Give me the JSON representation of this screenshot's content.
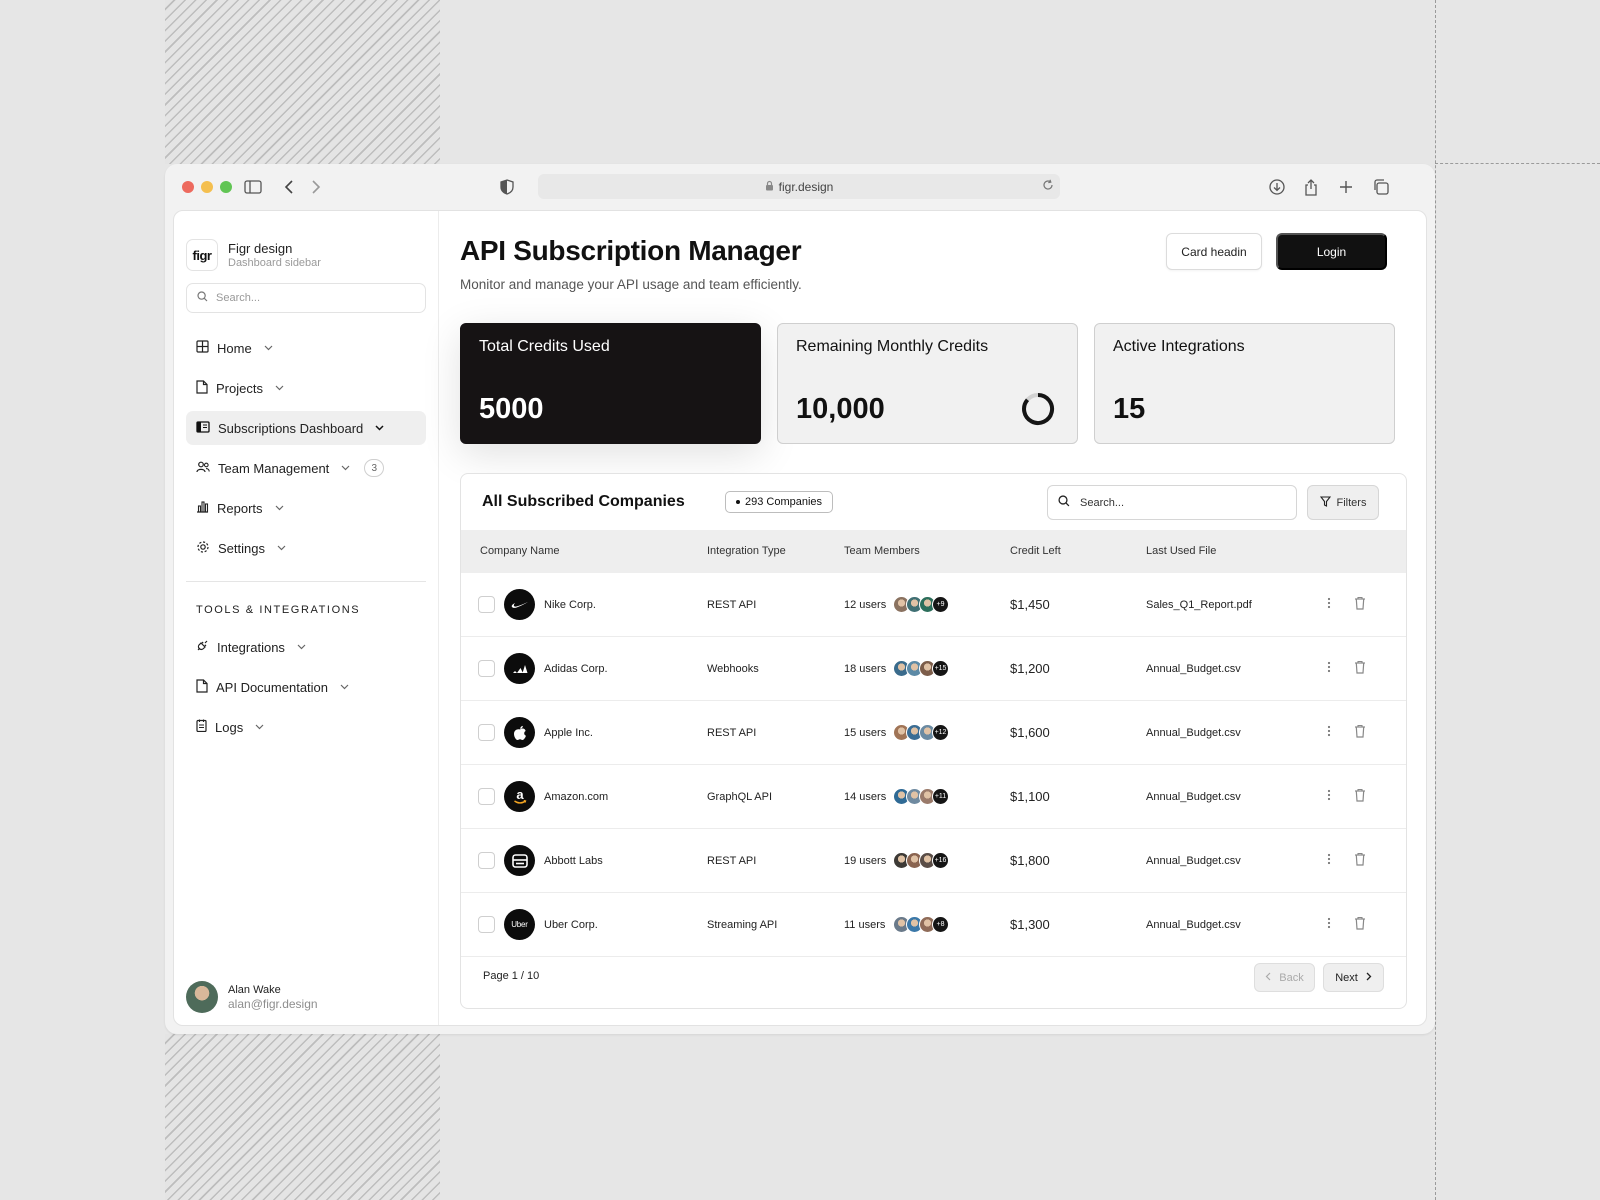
{
  "browser": {
    "url": "figr.design"
  },
  "sidebar": {
    "brand_logo": "figr",
    "brand_title": "Figr design",
    "brand_subtitle": "Dashboard sidebar",
    "search_placeholder": "Search...",
    "nav": [
      {
        "label": "Home",
        "icon": "grid-icon"
      },
      {
        "label": "Projects",
        "icon": "file-icon"
      },
      {
        "label": "Subscriptions Dashboard",
        "icon": "layout-icon",
        "active": true
      },
      {
        "label": "Team Management",
        "icon": "users-icon",
        "badge": "3"
      },
      {
        "label": "Reports",
        "icon": "bar-chart-icon"
      },
      {
        "label": "Settings",
        "icon": "gear-icon"
      }
    ],
    "tools_label": "TOOLS & INTEGRATIONS",
    "tools": [
      {
        "label": "Integrations",
        "icon": "plug-icon"
      },
      {
        "label": "API Documentation",
        "icon": "file-icon"
      },
      {
        "label": "Logs",
        "icon": "log-icon"
      }
    ],
    "user": {
      "name": "Alan Wake",
      "email": "alan@figr.design"
    }
  },
  "header": {
    "title": "API Subscription Manager",
    "subtitle": "Monitor and manage your API usage and team efficiently.",
    "secondary_button": "Card headin",
    "primary_button": "Login"
  },
  "stats": [
    {
      "label": "Total Credits Used",
      "value": "5000"
    },
    {
      "label": "Remaining Monthly  Credits",
      "value": "10,000"
    },
    {
      "label": "Active Integrations",
      "value": "15"
    }
  ],
  "table": {
    "title": "All Subscribed Companies",
    "badge": "293 Companies",
    "search_placeholder": "Search...",
    "filters_label": "Filters",
    "columns": [
      "Company Name",
      "Integration Type",
      "Team Members",
      "Credit Left",
      "Last Used File"
    ],
    "rows": [
      {
        "company": "Nike Corp.",
        "logo": "nike-logo-icon",
        "type": "REST API",
        "users": "12 users",
        "more": "+9",
        "credit": "$1,450",
        "file": "Sales_Q1_Report.pdf"
      },
      {
        "company": "Adidas Corp.",
        "logo": "adidas-logo-icon",
        "type": "Webhooks",
        "users": "18 users",
        "more": "+15",
        "credit": "$1,200",
        "file": "Annual_Budget.csv"
      },
      {
        "company": "Apple Inc.",
        "logo": "apple-logo-icon",
        "type": "REST API",
        "users": "15 users",
        "more": "+12",
        "credit": "$1,600",
        "file": "Annual_Budget.csv"
      },
      {
        "company": "Amazon.com",
        "logo": "amazon-logo-icon",
        "type": "GraphQL API",
        "users": "14 users",
        "more": "+11",
        "credit": "$1,100",
        "file": "Annual_Budget.csv"
      },
      {
        "company": "Abbott Labs",
        "logo": "abbott-logo-icon",
        "type": "REST API",
        "users": "19 users",
        "more": "+16",
        "credit": "$1,800",
        "file": "Annual_Budget.csv"
      },
      {
        "company": "Uber Corp.",
        "logo": "uber-logo-icon",
        "logo_text": "Uber",
        "type": "Streaming API",
        "users": "11 users",
        "more": "+8",
        "credit": "$1,300",
        "file": "Annual_Budget.csv"
      }
    ],
    "pagination": {
      "info": "Page 1 / 10",
      "back": "Back",
      "next": "Next"
    }
  }
}
